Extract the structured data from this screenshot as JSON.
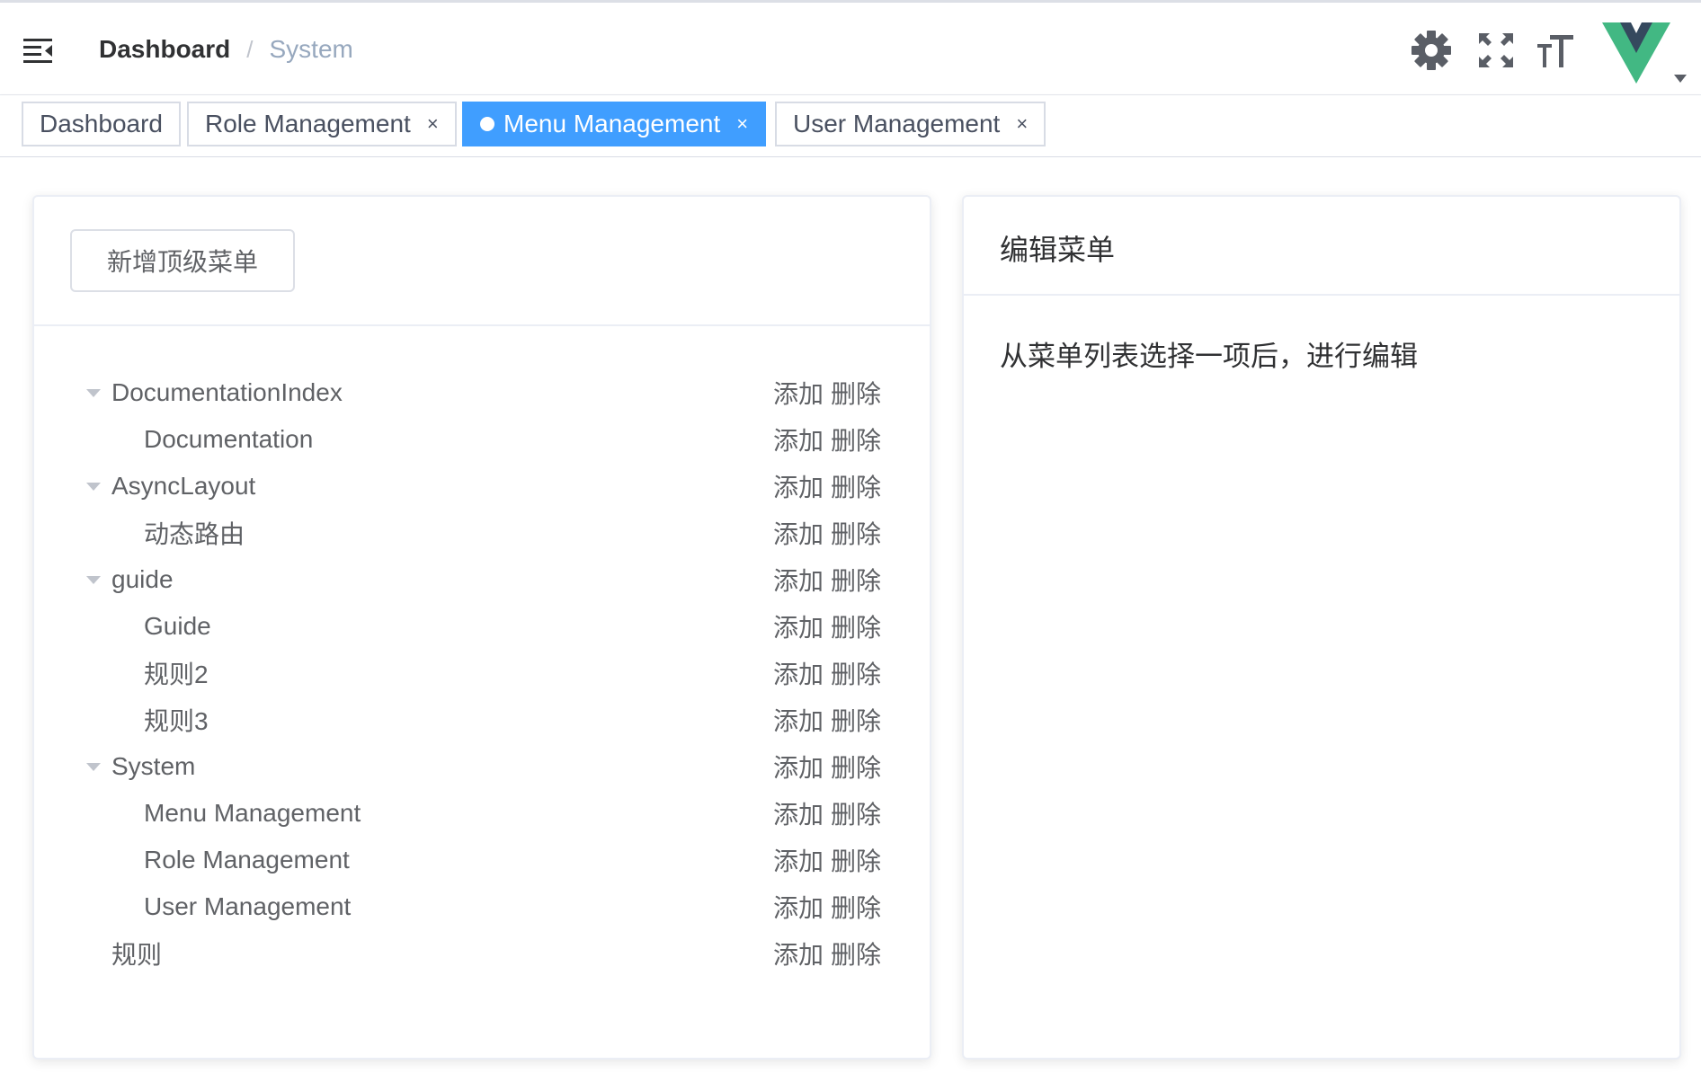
{
  "navbar": {
    "breadcrumb": {
      "home": "Dashboard",
      "separator": "/",
      "current": "System"
    },
    "icons": [
      "menu-fold-icon",
      "gear-icon",
      "fullscreen-icon",
      "text-size-icon"
    ],
    "avatar_color": "#42b883"
  },
  "tags": [
    {
      "label": "Dashboard",
      "closable": false,
      "active": false
    },
    {
      "label": "Role Management",
      "closable": true,
      "active": false
    },
    {
      "label": "Menu Management",
      "closable": true,
      "active": true
    },
    {
      "label": "User Management",
      "closable": true,
      "active": false
    }
  ],
  "tag_close": "×",
  "colors": {
    "accent": "#409eff",
    "text": "#606266"
  },
  "left_panel": {
    "add_top_menu": "新增顶级菜单",
    "actions": {
      "add": "添加",
      "delete": "删除"
    },
    "tree": [
      {
        "label": "DocumentationIndex",
        "level": 0,
        "expanded": true
      },
      {
        "label": "Documentation",
        "level": 1
      },
      {
        "label": "AsyncLayout",
        "level": 0,
        "expanded": true
      },
      {
        "label": "动态路由",
        "level": 1
      },
      {
        "label": "guide",
        "level": 0,
        "expanded": true
      },
      {
        "label": "Guide",
        "level": 1
      },
      {
        "label": "规则2",
        "level": 1
      },
      {
        "label": "规则3",
        "level": 1
      },
      {
        "label": "System",
        "level": 0,
        "expanded": true
      },
      {
        "label": "Menu Management",
        "level": 1
      },
      {
        "label": "Role Management",
        "level": 1
      },
      {
        "label": "User Management",
        "level": 1
      },
      {
        "label": "规则",
        "level": 0,
        "expanded": false
      }
    ]
  },
  "right_panel": {
    "title": "编辑菜单",
    "hint": "从菜单列表选择一项后，进行编辑"
  }
}
